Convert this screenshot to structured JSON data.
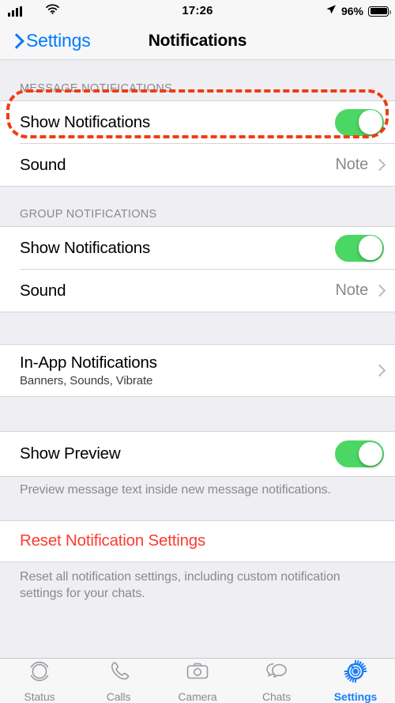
{
  "status_bar": {
    "signal_icon": "cellular-signal-icon",
    "wifi_icon": "wifi-icon",
    "time": "17:26",
    "location_icon": "location-arrow-icon",
    "battery_percent": "96%",
    "battery_icon": "battery-full-icon"
  },
  "nav": {
    "back_icon": "chevron-left-icon",
    "back_label": "Settings",
    "title": "Notifications"
  },
  "sections": {
    "message": {
      "header": "MESSAGE NOTIFICATIONS",
      "show_notifications_label": "Show Notifications",
      "show_notifications_state": "on",
      "sound_label": "Sound",
      "sound_value": "Note"
    },
    "group": {
      "header": "GROUP NOTIFICATIONS",
      "show_notifications_label": "Show Notifications",
      "show_notifications_state": "on",
      "sound_label": "Sound",
      "sound_value": "Note"
    },
    "in_app": {
      "title": "In-App Notifications",
      "subtitle": "Banners, Sounds, Vibrate"
    },
    "preview": {
      "label": "Show Preview",
      "state": "on",
      "footnote": "Preview message text inside new message notifications.",
      "highlighted": true,
      "highlight_color": "#f03c12"
    },
    "reset": {
      "label": "Reset Notification Settings",
      "footnote": "Reset all notification settings, including custom notification settings for your chats."
    }
  },
  "tabbar": {
    "items": [
      {
        "label": "Status",
        "icon": "status-rings-icon",
        "active": false
      },
      {
        "label": "Calls",
        "icon": "phone-icon",
        "active": false
      },
      {
        "label": "Camera",
        "icon": "camera-icon",
        "active": false
      },
      {
        "label": "Chats",
        "icon": "chat-bubbles-icon",
        "active": false
      },
      {
        "label": "Settings",
        "icon": "gear-icon",
        "active": true
      }
    ]
  },
  "colors": {
    "accent_blue": "#007aff",
    "toggle_green": "#4bd763",
    "destructive_red": "#fc3b30",
    "annotation_red": "#f03c12"
  }
}
